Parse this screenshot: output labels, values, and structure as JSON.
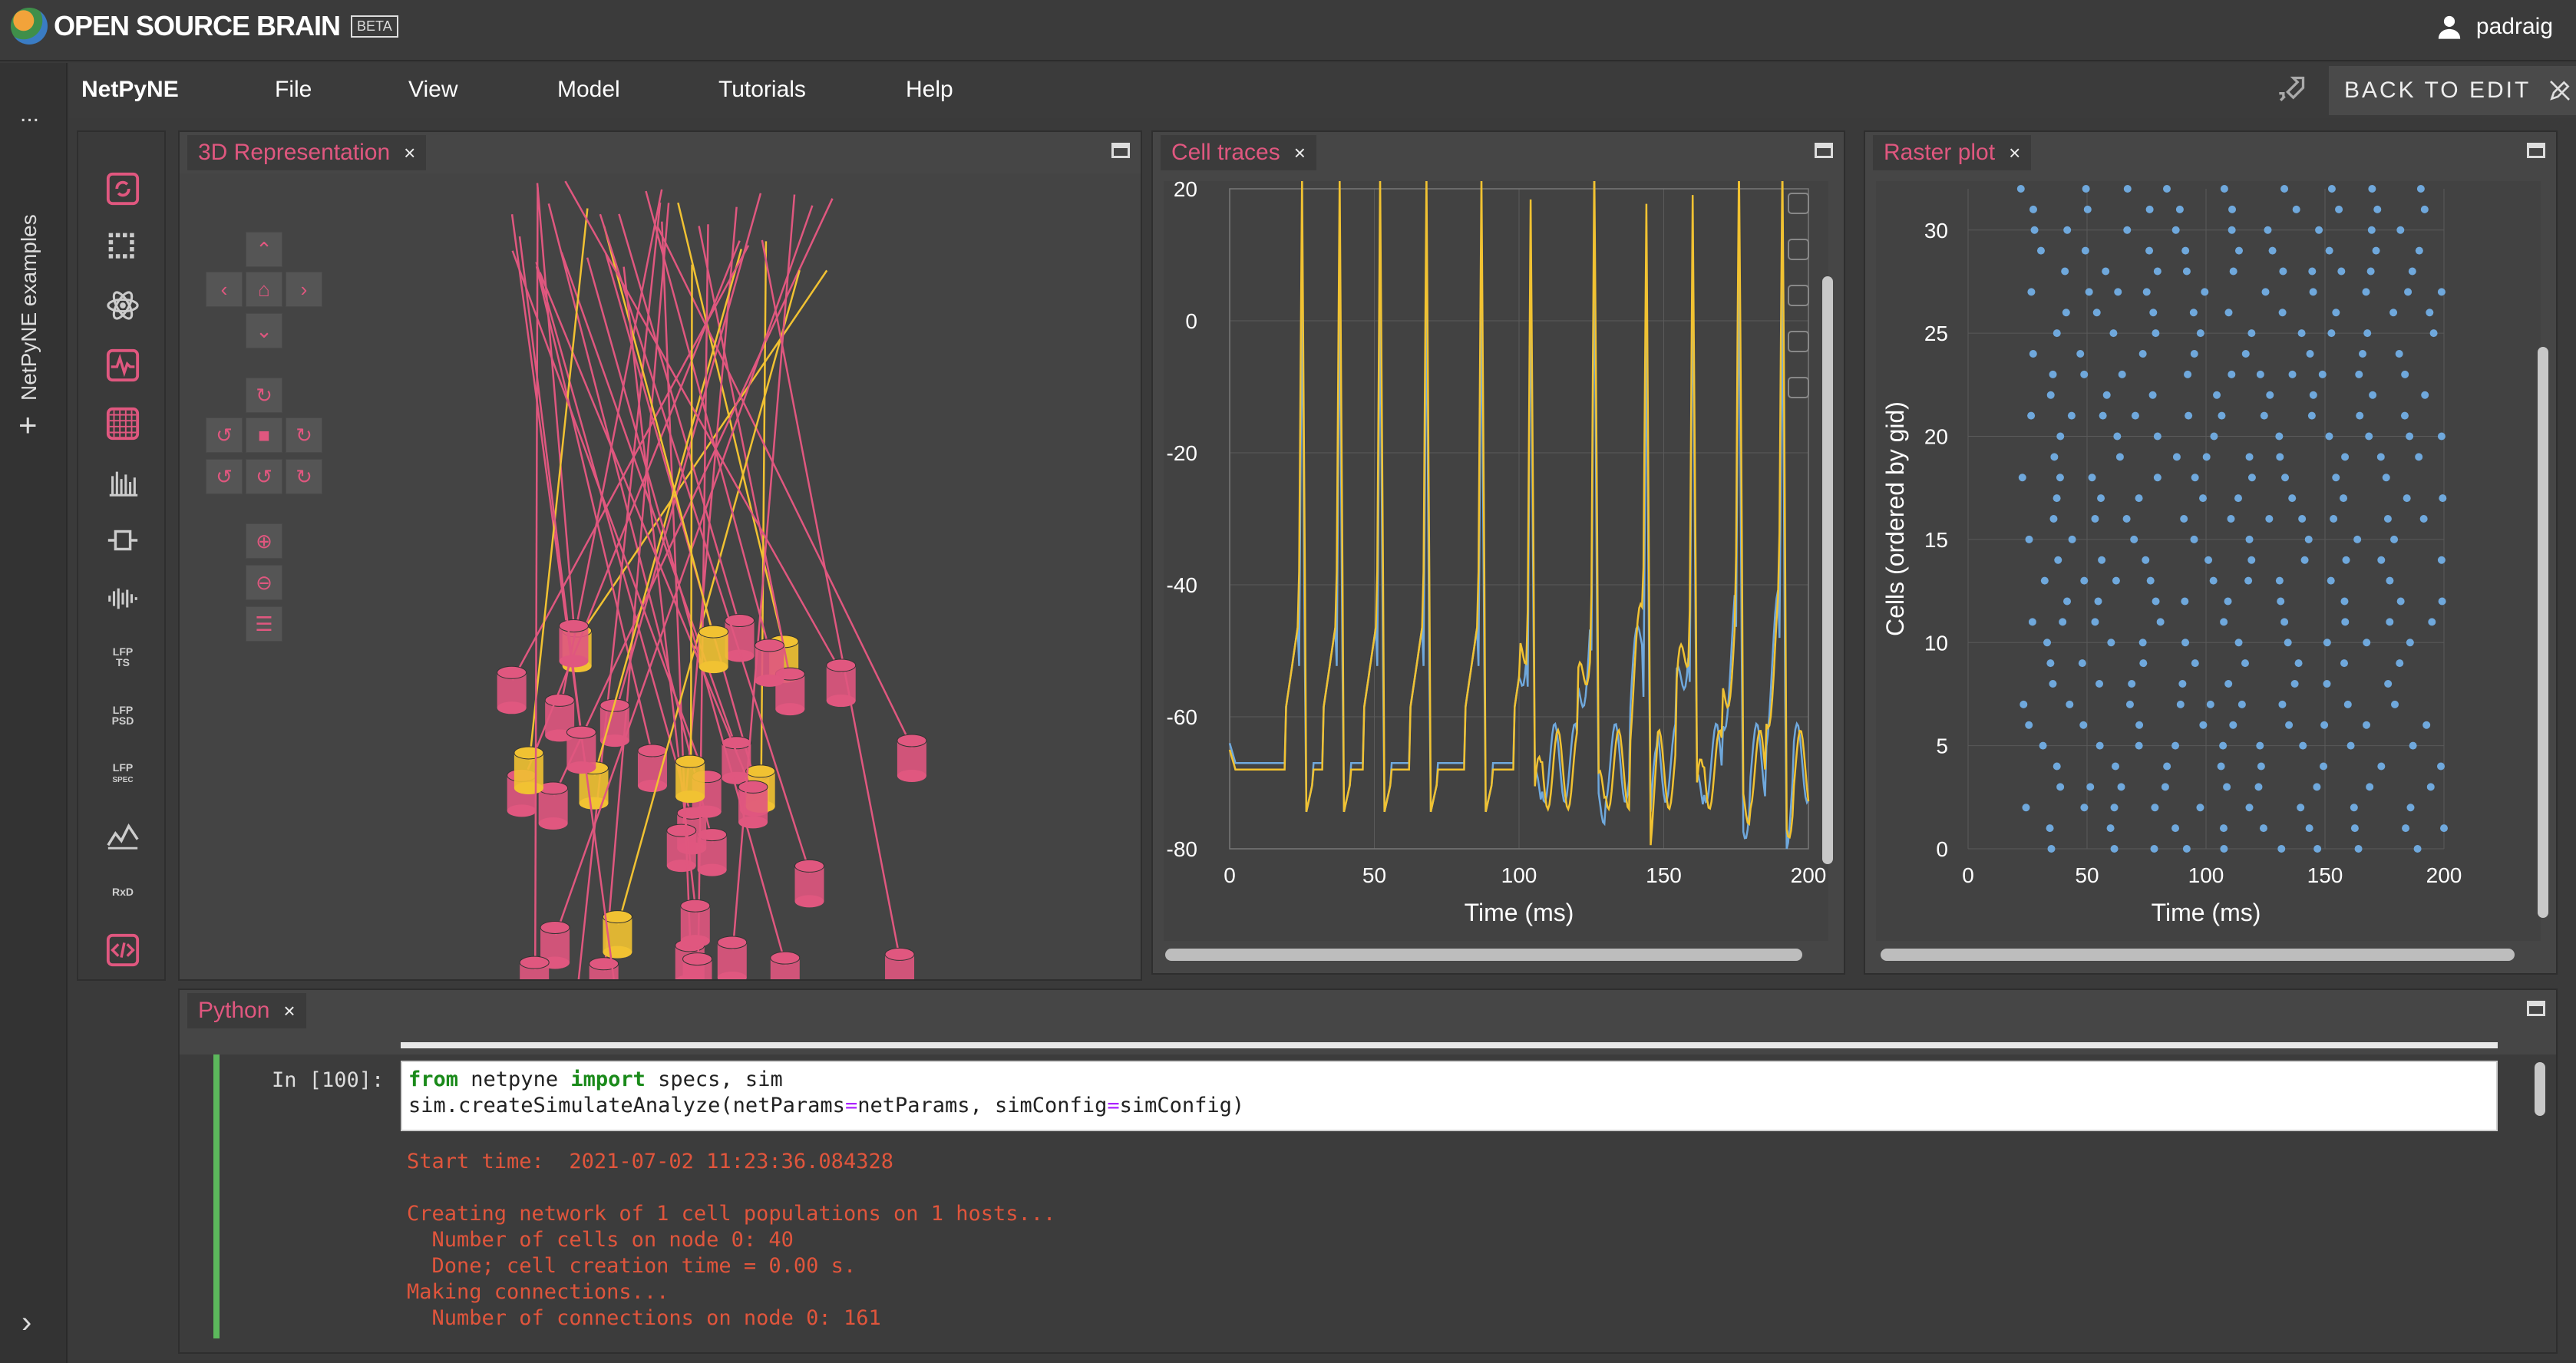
{
  "header": {
    "logo_text": "OPEN SOURCE BRAIN",
    "badge": "BETA",
    "username": "padraig"
  },
  "left_rail": {
    "dots": "...",
    "vertical_label": "NetPyNE examples",
    "plus": "+",
    "collapse": "›"
  },
  "menubar": {
    "brand": "NetPyNE",
    "items": [
      "File",
      "View",
      "Model",
      "Tutorials",
      "Help"
    ],
    "back_to_edit": "BACK TO EDIT"
  },
  "toolbar": {
    "tools": [
      "LFP TS",
      "LFP PSD",
      "LFP SPEC",
      "RxD"
    ],
    "lfp_ts_top": "LFP",
    "lfp_ts_bottom": "TS",
    "lfp_psd_top": "LFP",
    "lfp_psd_bottom": "PSD",
    "lfp_spec_top": "LFP",
    "lfp_spec_bottom": "SPEC",
    "rxd": "RxD"
  },
  "panels": {
    "three_d": {
      "title": "3D Representation",
      "close": "×"
    },
    "cell_traces": {
      "title": "Cell traces",
      "close": "×"
    },
    "raster": {
      "title": "Raster plot",
      "close": "×"
    },
    "python": {
      "title": "Python",
      "close": "×"
    }
  },
  "python": {
    "prompt": "In [100]:",
    "code_line1_kw1": "from",
    "code_line1_mid": " netpyne ",
    "code_line1_kw2": "import",
    "code_line1_end": " specs, sim",
    "code_line2_a": "sim.createSimulateAnalyze(netParams",
    "code_line2_eq1": "=",
    "code_line2_b": "netParams, simConfig",
    "code_line2_eq2": "=",
    "code_line2_c": "simConfig)",
    "output": [
      "Start time:  2021-07-02 11:23:36.084328",
      "",
      "Creating network of 1 cell populations on 1 hosts...",
      "  Number of cells on node 0: 40",
      "  Done; cell creation time = 0.00 s.",
      "Making connections...",
      "  Number of connections on node 0: 161"
    ]
  },
  "colors": {
    "accent": "#e0577f",
    "trace_blue": "#6fa8dc",
    "trace_yellow": "#f1c232",
    "raster_dot": "#6fa8dc",
    "green": "#5cb85c"
  },
  "chart_data": [
    {
      "type": "line",
      "title": "Cell traces",
      "xlabel": "Time (ms)",
      "ylabel": "",
      "xlim": [
        0,
        200
      ],
      "ylim": [
        -80,
        20
      ],
      "xticks": [
        0,
        50,
        100,
        150,
        200
      ],
      "yticks": [
        20,
        0,
        -20,
        -40,
        -60,
        -80
      ],
      "grid": true,
      "spike_times_yellow": [
        25,
        38,
        52,
        68,
        87,
        104,
        126,
        144,
        160,
        176,
        191
      ],
      "spike_peak": 22,
      "resting": -68
    },
    {
      "type": "scatter",
      "title": "Raster plot",
      "xlabel": "Time (ms)",
      "ylabel": "Cells (ordered by gid)",
      "xlim": [
        0,
        200
      ],
      "ylim": [
        0,
        32
      ],
      "xticks": [
        0,
        50,
        100,
        150,
        200
      ],
      "yticks": [
        0,
        5,
        10,
        15,
        20,
        25,
        30
      ],
      "grid": true
    }
  ]
}
